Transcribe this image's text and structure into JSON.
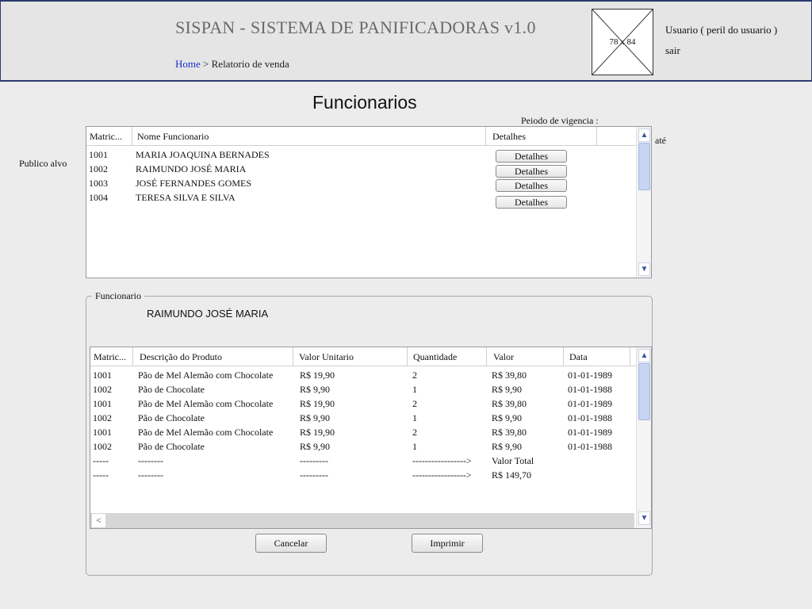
{
  "header": {
    "app_title": "SISPAN - SISTEMA DE PANIFICADORAS v1.0",
    "breadcrumb_home": "Home",
    "breadcrumb_sep": " > ",
    "breadcrumb_current": "Relatorio de venda",
    "avatar_placeholder": "78 x 84",
    "user_label": "Usuario ( peril do usuario )",
    "logout_label": "sair"
  },
  "page_title": "Funcionarios",
  "filters": {
    "periodo_label": "Peiodo de vigencia :",
    "ate_label": "até",
    "publico_label": "Publico alvo"
  },
  "employees_table": {
    "columns": [
      "Matric...",
      "Nome Funcionario",
      "Detalhes"
    ],
    "detail_button_label": "Detalhes",
    "rows": [
      {
        "matricula": "1001",
        "nome": "MARIA JOAQUINA BERNADES"
      },
      {
        "matricula": "1002",
        "nome": "RAIMUNDO JOSÉ MARIA"
      },
      {
        "matricula": "1003",
        "nome": "JOSÉ FERNANDES GOMES"
      },
      {
        "matricula": "1004",
        "nome": "TERESA SILVA E SILVA"
      }
    ]
  },
  "funcionario_section": {
    "legend": "Funcionario",
    "selected_name": "RAIMUNDO JOSÉ MARIA"
  },
  "sales_table": {
    "columns": [
      "Matric...",
      "Descrição do Produto",
      "Valor Unitario",
      "Quantidade",
      "Valor",
      "Data"
    ],
    "rows": [
      [
        "1001",
        "Pão de Mel Alemão com Chocolate",
        "R$ 19,90",
        "2",
        "R$ 39,80",
        "01-01-1989"
      ],
      [
        "1002",
        "Pão de Chocolate",
        "R$ 9,90",
        "1",
        "R$ 9,90",
        "01-01-1988"
      ],
      [
        "1001",
        "Pão de Mel Alemão com Chocolate",
        "R$ 19,90",
        "2",
        "R$ 39,80",
        "01-01-1989"
      ],
      [
        "1002",
        "Pão de Chocolate",
        "R$ 9,90",
        "1",
        "R$ 9,90",
        "01-01-1988"
      ],
      [
        "1001",
        "Pão de Mel Alemão com Chocolate",
        "R$ 19,90",
        "2",
        "R$ 39,80",
        "01-01-1989"
      ],
      [
        "1002",
        "Pão de Chocolate",
        "R$ 9,90",
        "1",
        "R$ 9,90",
        "01-01-1988"
      ],
      [
        "-----",
        "--------",
        "---------",
        "----------------->",
        "Valor Total",
        ""
      ],
      [
        "-----",
        "--------",
        "---------",
        "----------------->",
        " R$ 149,70",
        ""
      ]
    ]
  },
  "actions": {
    "cancel_label": "Cancelar",
    "print_label": "Imprimir"
  }
}
